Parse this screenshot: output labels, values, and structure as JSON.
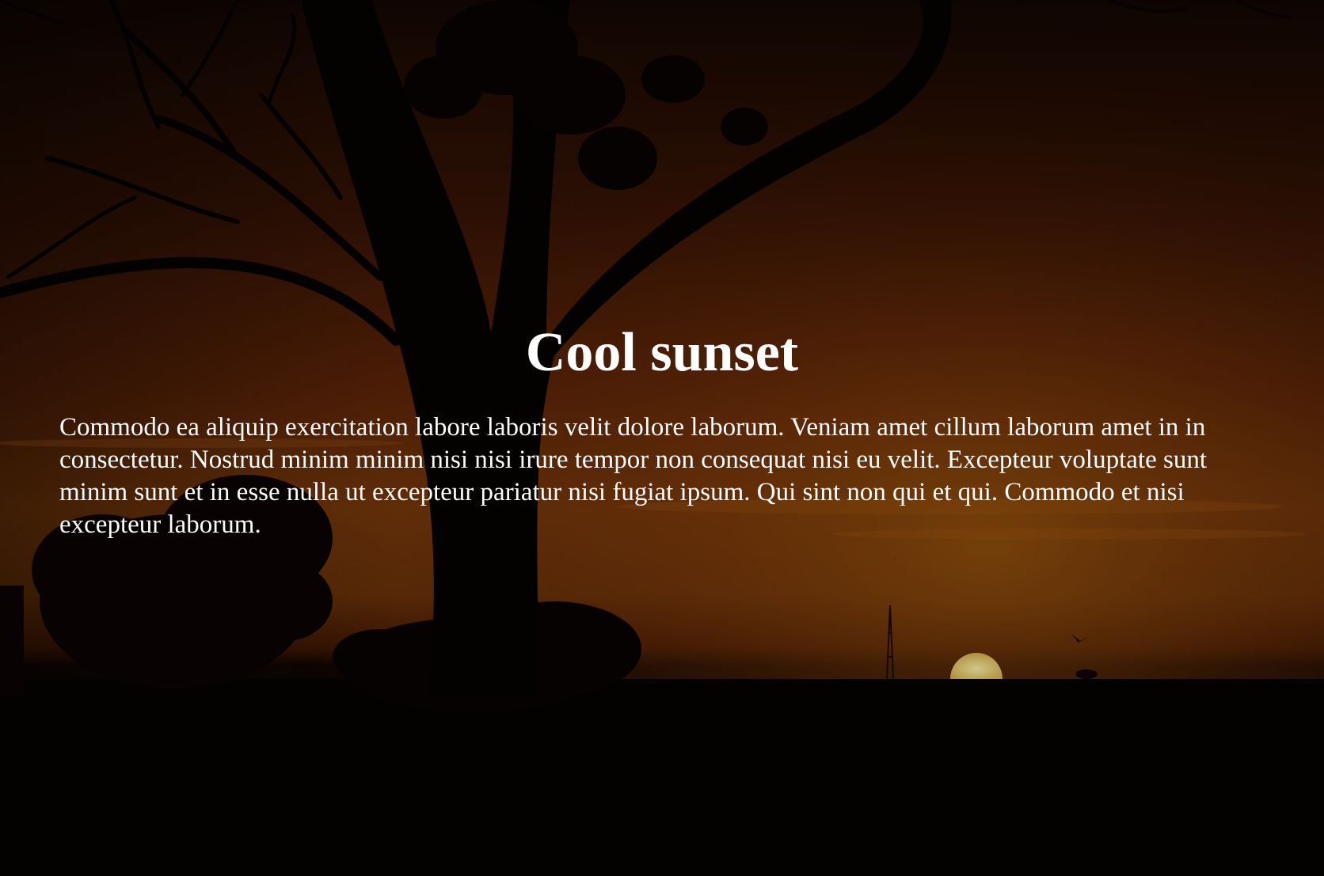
{
  "hero": {
    "title": "Cool sunset",
    "paragraph": "Commodo ea aliquip exercitation labore laboris velit dolore laborum. Veniam amet cillum laborum amet in in consectetur. Nostrud minim minim nisi nisi irure tempor non consequat nisi eu velit. Excepteur voluptate sunt minim sunt et in esse nulla ut excepteur pariatur nisi fugiat ipsum. Qui sint non qui et qui. Commodo et nisi excepteur laborum."
  },
  "colors": {
    "text": "#ffffff",
    "sky_dark": "#1c0a03",
    "sky_orange": "#7a300b",
    "sky_glow": "#b0620f",
    "sun": "#f1d66a",
    "silhouette": "#060302"
  },
  "background": {
    "description_icon": "sunset-photo"
  }
}
